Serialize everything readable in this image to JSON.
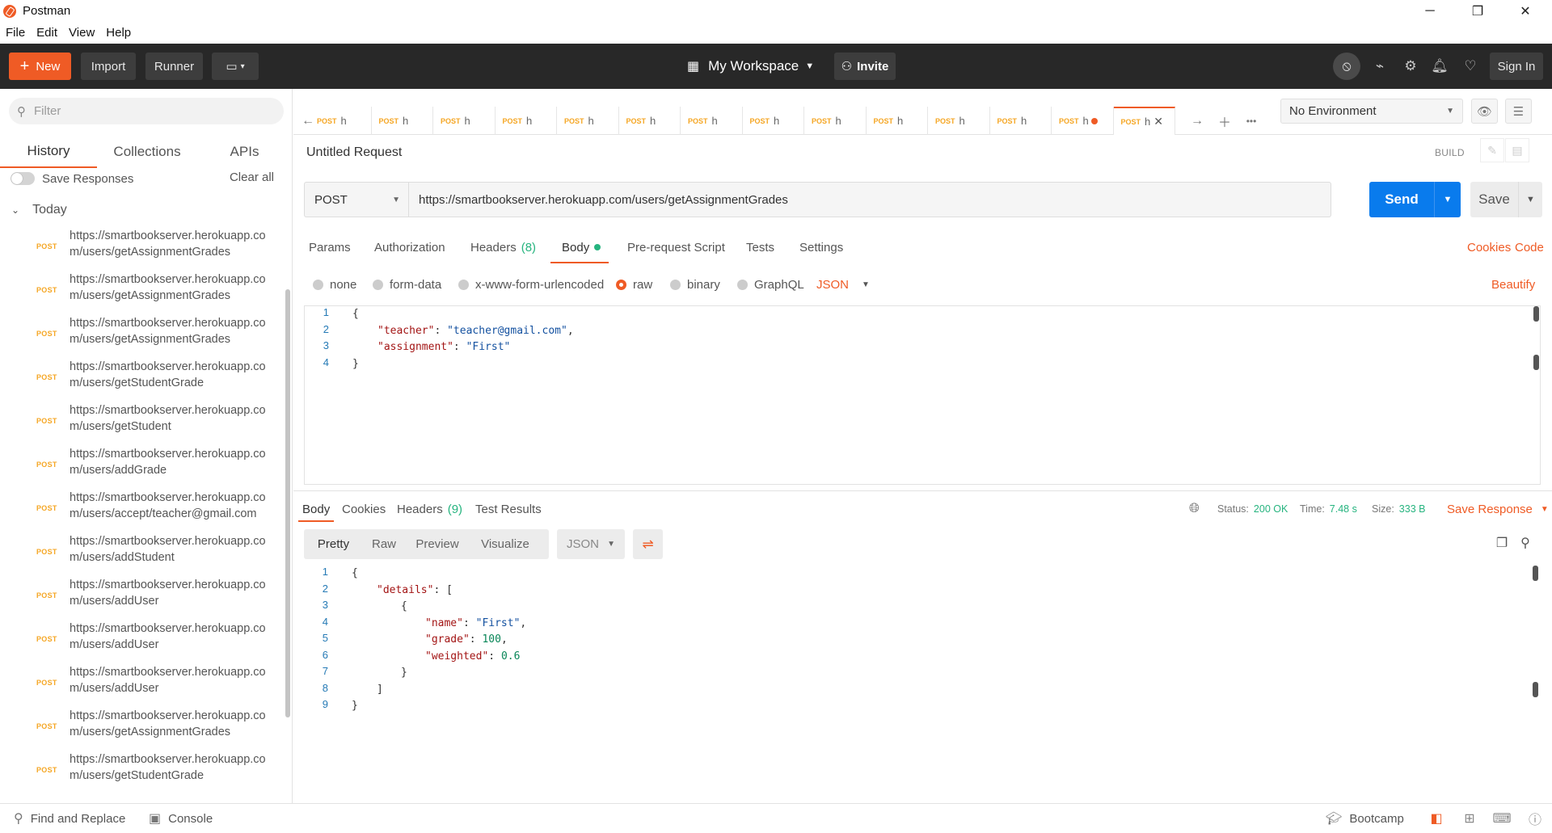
{
  "window": {
    "title": "Postman",
    "minimize": "─",
    "restore": "❐",
    "close": "✕"
  },
  "menu": [
    "File",
    "Edit",
    "View",
    "Help"
  ],
  "header": {
    "new_label": "New",
    "import_label": "Import",
    "runner_label": "Runner",
    "workspace_label": "My Workspace",
    "invite_label": "Invite",
    "signin_label": "Sign In"
  },
  "sidebar": {
    "filter_placeholder": "Filter",
    "tabs": [
      "History",
      "Collections",
      "APIs"
    ],
    "active_tab": "History",
    "save_responses_label": "Save Responses",
    "clear_all_label": "Clear all",
    "group_label": "Today",
    "history": [
      {
        "method": "POST",
        "url": "https://smartbookserver.herokuapp.com/users/getAssignmentGrades"
      },
      {
        "method": "POST",
        "url": "https://smartbookserver.herokuapp.com/users/getAssignmentGrades"
      },
      {
        "method": "POST",
        "url": "https://smartbookserver.herokuapp.com/users/getAssignmentGrades"
      },
      {
        "method": "POST",
        "url": "https://smartbookserver.herokuapp.com/users/getStudentGrade"
      },
      {
        "method": "POST",
        "url": "https://smartbookserver.herokuapp.com/users/getStudent"
      },
      {
        "method": "POST",
        "url": "https://smartbookserver.herokuapp.com/users/addGrade"
      },
      {
        "method": "POST",
        "url": "https://smartbookserver.herokuapp.com/users/accept/teacher@gmail.com"
      },
      {
        "method": "POST",
        "url": "https://smartbookserver.herokuapp.com/users/addStudent"
      },
      {
        "method": "POST",
        "url": "https://smartbookserver.herokuapp.com/users/addUser"
      },
      {
        "method": "POST",
        "url": "https://smartbookserver.herokuapp.com/users/addUser"
      },
      {
        "method": "POST",
        "url": "https://smartbookserver.herokuapp.com/users/addUser"
      },
      {
        "method": "POST",
        "url": "https://smartbookserver.herokuapp.com/users/getAssignmentGrades"
      },
      {
        "method": "POST",
        "url": "https://smartbookserver.herokuapp.com/users/getStudentGrade"
      }
    ]
  },
  "request_tabs": [
    {
      "method": "POST",
      "title": "h"
    },
    {
      "method": "POST",
      "title": "h"
    },
    {
      "method": "POST",
      "title": "h"
    },
    {
      "method": "POST",
      "title": "h"
    },
    {
      "method": "POST",
      "title": "h"
    },
    {
      "method": "POST",
      "title": "h"
    },
    {
      "method": "POST",
      "title": "h"
    },
    {
      "method": "POST",
      "title": "h"
    },
    {
      "method": "POST",
      "title": "h"
    },
    {
      "method": "POST",
      "title": "h"
    },
    {
      "method": "POST",
      "title": "h"
    },
    {
      "method": "POST",
      "title": "h"
    },
    {
      "method": "POST",
      "title": "h"
    },
    {
      "method": "POST",
      "title": "h"
    }
  ],
  "environment": {
    "selected": "No Environment"
  },
  "request": {
    "name": "Untitled Request",
    "build_label": "BUILD",
    "method": "POST",
    "url": "https://smartbookserver.herokuapp.com/users/getAssignmentGrades",
    "send_label": "Send",
    "save_label": "Save",
    "tabs": {
      "params": "Params",
      "authorization": "Authorization",
      "headers": "Headers",
      "headers_count": "(8)",
      "body": "Body",
      "prerequest": "Pre-request Script",
      "tests": "Tests",
      "settings": "Settings"
    },
    "cookies_label": "Cookies",
    "code_label": "Code",
    "body_types": {
      "none": "none",
      "form_data": "form-data",
      "urlencoded": "x-www-form-urlencoded",
      "raw": "raw",
      "binary": "binary",
      "graphql": "GraphQL",
      "json": "JSON"
    },
    "beautify_label": "Beautify",
    "body_lines": [
      "{",
      "\"teacher\": \"teacher@gmail.com\",",
      "\"assignment\": \"First\"",
      "}"
    ]
  },
  "response": {
    "tabs": {
      "body": "Body",
      "cookies": "Cookies",
      "headers": "Headers",
      "headers_count": "(9)",
      "test_results": "Test Results"
    },
    "status_label": "Status:",
    "status_value": "200 OK",
    "time_label": "Time:",
    "time_value": "7.48 s",
    "size_label": "Size:",
    "size_value": "333 B",
    "save_response_label": "Save Response",
    "views": {
      "pretty": "Pretty",
      "raw": "Raw",
      "preview": "Preview",
      "visualize": "Visualize"
    },
    "format": "JSON",
    "line_numbers": [
      "1",
      "2",
      "3",
      "4",
      "5",
      "6",
      "7",
      "8",
      "9"
    ]
  },
  "footer": {
    "find_replace_label": "Find and Replace",
    "console_label": "Console",
    "bootcamp_label": "Bootcamp"
  },
  "colors": {
    "accent": "#ef5b25",
    "send": "#097bed",
    "success": "#26b47f",
    "method_post": "#f5a623"
  }
}
